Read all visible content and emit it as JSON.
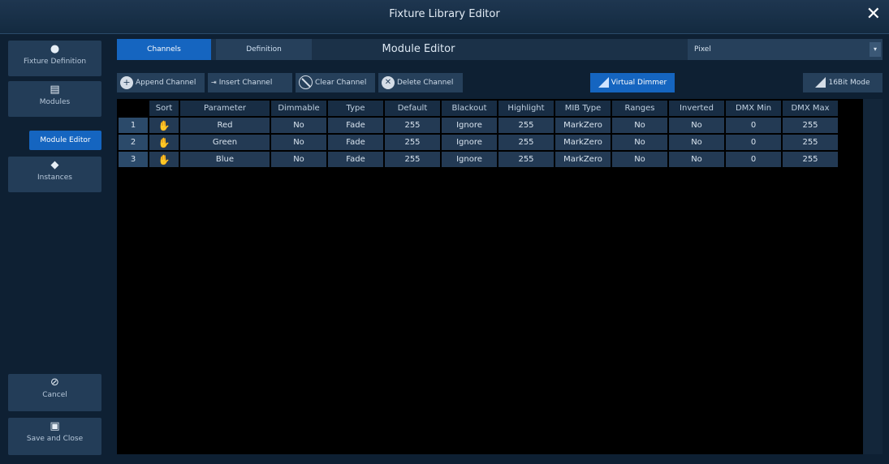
{
  "window": {
    "title": "Fixture Library Editor"
  },
  "sidebar": {
    "fixture_definition": {
      "label": "Fixture Definition",
      "icon": "bulb-icon"
    },
    "modules": {
      "label": "Modules",
      "icon": "document-icon"
    },
    "module_editor": {
      "label": "Module Editor"
    },
    "instances": {
      "label": "Instances",
      "icon": "cube-icon"
    },
    "cancel": {
      "label": "Cancel",
      "icon": "cancel-icon"
    },
    "save": {
      "label": "Save and Close",
      "icon": "save-icon"
    }
  },
  "tabs": {
    "channels": "Channels",
    "definition": "Definition"
  },
  "module_title": "Module Editor",
  "module_select": {
    "value": "Pixel"
  },
  "toolbar": {
    "append": "Append Channel",
    "insert": "Insert Channel",
    "clear": "Clear Channel",
    "delete": "Delete Channel",
    "virtual_dimmer": "Virtual Dimmer",
    "bit16": "16Bit Mode"
  },
  "colors": {
    "accent": "#1565c0",
    "panel": "#26405b",
    "background": "#0e2033"
  },
  "table": {
    "columns": [
      "",
      "Sort",
      "Parameter",
      "Dimmable",
      "Type",
      "Default",
      "Blackout",
      "Highlight",
      "MIB Type",
      "Ranges",
      "Inverted",
      "DMX Min",
      "DMX Max"
    ],
    "rows": [
      {
        "num": "1",
        "parameter": "Red",
        "dimmable": "No",
        "type": "Fade",
        "default": "255",
        "blackout": "Ignore",
        "highlight": "255",
        "mib": "MarkZero",
        "ranges": "No",
        "inverted": "No",
        "dmx_min": "0",
        "dmx_max": "255"
      },
      {
        "num": "2",
        "parameter": "Green",
        "dimmable": "No",
        "type": "Fade",
        "default": "255",
        "blackout": "Ignore",
        "highlight": "255",
        "mib": "MarkZero",
        "ranges": "No",
        "inverted": "No",
        "dmx_min": "0",
        "dmx_max": "255"
      },
      {
        "num": "3",
        "parameter": "Blue",
        "dimmable": "No",
        "type": "Fade",
        "default": "255",
        "blackout": "Ignore",
        "highlight": "255",
        "mib": "MarkZero",
        "ranges": "No",
        "inverted": "No",
        "dmx_min": "0",
        "dmx_max": "255"
      }
    ]
  }
}
